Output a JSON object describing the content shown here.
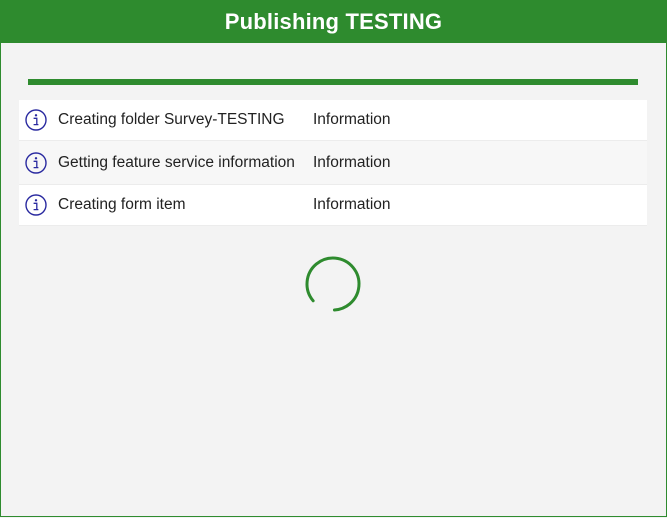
{
  "window": {
    "title": "Publishing TESTING"
  },
  "colors": {
    "accent": "#2e8b2e",
    "info_icon": "#2a2aa0"
  },
  "progress": {
    "fraction": 1.0
  },
  "log": {
    "items": [
      {
        "icon": "info-icon",
        "message": "Creating folder Survey-TESTING",
        "level": "Information"
      },
      {
        "icon": "info-icon",
        "message": "Getting feature service information",
        "level": "Information"
      },
      {
        "icon": "info-icon",
        "message": "Creating form item",
        "level": "Information"
      }
    ]
  },
  "status": {
    "busy_indicator": "spinner-icon"
  }
}
